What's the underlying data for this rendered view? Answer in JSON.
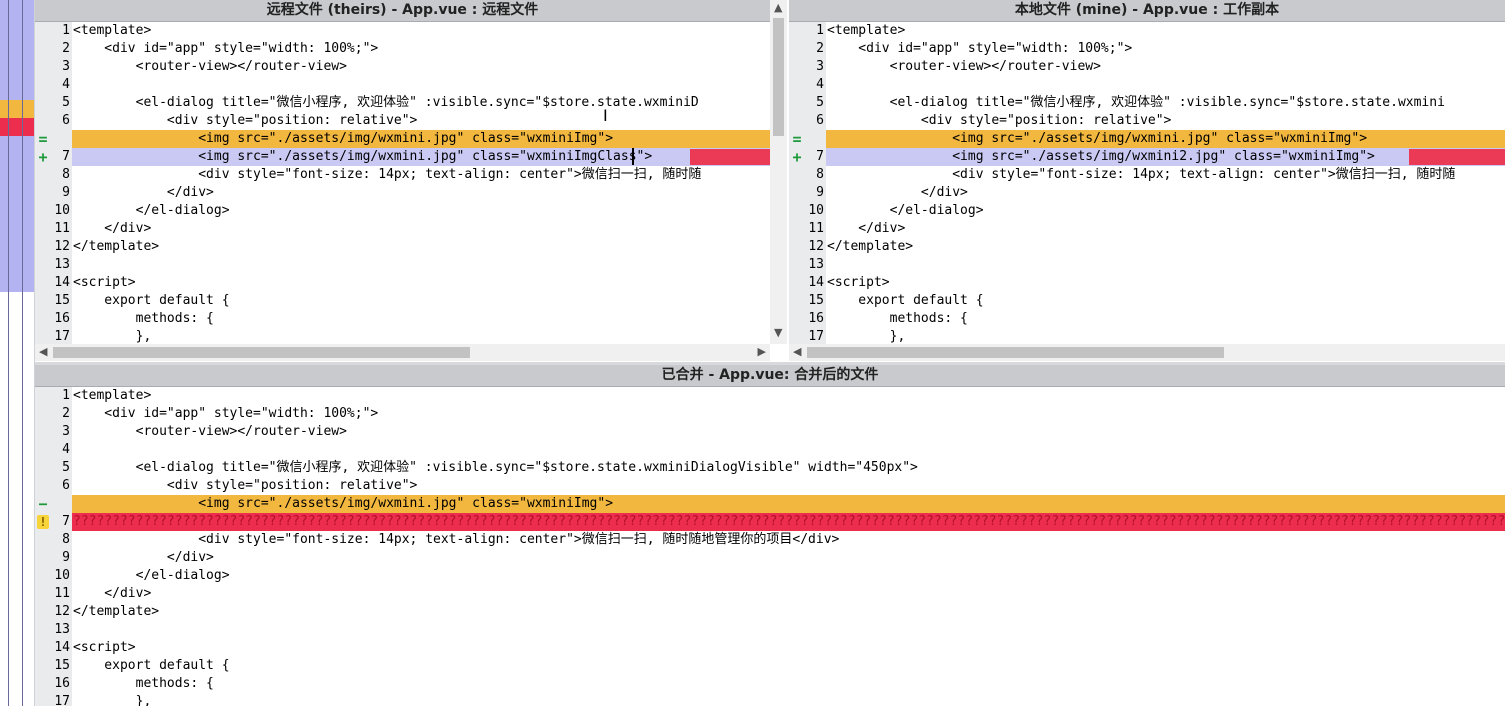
{
  "colors": {
    "conflict": "#f2b73f",
    "changed": "#c9c9f3",
    "error": "#ec2d4d",
    "highlight": "#f7f26a"
  },
  "left_pane": {
    "title": "远程文件 (theirs) - App.vue : 远程文件",
    "lines": [
      {
        "n": "1",
        "mark": "",
        "marker_icon": "",
        "code": "<template>"
      },
      {
        "n": "2",
        "mark": "",
        "marker_icon": "",
        "code": "    <div id=\"app\" style=\"width: 100%;\">"
      },
      {
        "n": "3",
        "mark": "",
        "marker_icon": "",
        "code": "        <router-view></router-view>"
      },
      {
        "n": "4",
        "mark": "",
        "marker_icon": "",
        "code": ""
      },
      {
        "n": "5",
        "mark": "",
        "marker_icon": "",
        "code": "        <el-dialog title=\"微信小程序, 欢迎体验\" :visible.sync=\"$store.state.wxminiD"
      },
      {
        "n": "6",
        "mark": "",
        "marker_icon": "",
        "code": "            <div style=\"position: relative\">"
      },
      {
        "n": "",
        "mark": "=",
        "marker_icon": "equal-icon",
        "code": "                <img src=\"./assets/img/wxmini.jpg\" class=\"wxminiImg\">"
      },
      {
        "n": "7",
        "mark": "+",
        "marker_icon": "plus-icon",
        "code": "                <img src=\"./assets/img/wxmini.jpg\" class=\"wxminiImgClass\">"
      },
      {
        "n": "8",
        "mark": "",
        "marker_icon": "",
        "code": "                <div style=\"font-size: 14px; text-align: center\">微信扫一扫, 随时随"
      },
      {
        "n": "9",
        "mark": "",
        "marker_icon": "",
        "code": "            </div>"
      },
      {
        "n": "10",
        "mark": "",
        "marker_icon": "",
        "code": "        </el-dialog>"
      },
      {
        "n": "11",
        "mark": "",
        "marker_icon": "",
        "code": "    </div>"
      },
      {
        "n": "12",
        "mark": "",
        "marker_icon": "",
        "code": "</template>"
      },
      {
        "n": "13",
        "mark": "",
        "marker_icon": "",
        "code": ""
      },
      {
        "n": "14",
        "mark": "",
        "marker_icon": "",
        "code": "<script>"
      },
      {
        "n": "15",
        "mark": "",
        "marker_icon": "",
        "code": "    export default {"
      },
      {
        "n": "16",
        "mark": "",
        "marker_icon": "",
        "code": "        methods: {"
      },
      {
        "n": "17",
        "mark": "",
        "marker_icon": "",
        "code": "        },"
      }
    ]
  },
  "right_pane": {
    "title": "本地文件 (mine) - App.vue : 工作副本",
    "lines": [
      {
        "n": "1",
        "mark": "",
        "marker_icon": "",
        "code": "<template>"
      },
      {
        "n": "2",
        "mark": "",
        "marker_icon": "",
        "code": "    <div id=\"app\" style=\"width: 100%;\">"
      },
      {
        "n": "3",
        "mark": "",
        "marker_icon": "",
        "code": "        <router-view></router-view>"
      },
      {
        "n": "4",
        "mark": "",
        "marker_icon": "",
        "code": ""
      },
      {
        "n": "5",
        "mark": "",
        "marker_icon": "",
        "code": "        <el-dialog title=\"微信小程序, 欢迎体验\" :visible.sync=\"$store.state.wxmini"
      },
      {
        "n": "6",
        "mark": "",
        "marker_icon": "",
        "code": "            <div style=\"position: relative\">"
      },
      {
        "n": "",
        "mark": "=",
        "marker_icon": "equal-icon",
        "code": "                <img src=\"./assets/img/wxmini.jpg\" class=\"wxminiImg\">"
      },
      {
        "n": "7",
        "mark": "+",
        "marker_icon": "plus-icon",
        "code": "                <img src=\"./assets/img/wxmini2.jpg\" class=\"wxminiImg\">"
      },
      {
        "n": "8",
        "mark": "",
        "marker_icon": "",
        "code": "                <div style=\"font-size: 14px; text-align: center\">微信扫一扫, 随时随"
      },
      {
        "n": "9",
        "mark": "",
        "marker_icon": "",
        "code": "            </div>"
      },
      {
        "n": "10",
        "mark": "",
        "marker_icon": "",
        "code": "        </el-dialog>"
      },
      {
        "n": "11",
        "mark": "",
        "marker_icon": "",
        "code": "    </div>"
      },
      {
        "n": "12",
        "mark": "",
        "marker_icon": "",
        "code": "</template>"
      },
      {
        "n": "13",
        "mark": "",
        "marker_icon": "",
        "code": ""
      },
      {
        "n": "14",
        "mark": "",
        "marker_icon": "",
        "code": "<script>"
      },
      {
        "n": "15",
        "mark": "",
        "marker_icon": "",
        "code": "    export default {"
      },
      {
        "n": "16",
        "mark": "",
        "marker_icon": "",
        "code": "        methods: {"
      },
      {
        "n": "17",
        "mark": "",
        "marker_icon": "",
        "code": "        },"
      }
    ]
  },
  "merged_pane": {
    "title": "已合并 - App.vue: 合并后的文件",
    "lines": [
      {
        "n": "1",
        "mark": "",
        "marker_icon": "",
        "code": "<template>"
      },
      {
        "n": "2",
        "mark": "",
        "marker_icon": "",
        "code": "    <div id=\"app\" style=\"width: 100%;\">"
      },
      {
        "n": "3",
        "mark": "",
        "marker_icon": "",
        "code": "        <router-view></router-view>"
      },
      {
        "n": "4",
        "mark": "",
        "marker_icon": "",
        "code": ""
      },
      {
        "n": "5",
        "mark": "",
        "marker_icon": "",
        "code": "        <el-dialog title=\"微信小程序, 欢迎体验\" :visible.sync=\"$store.state.wxminiDialogVisible\" width=\"450px\">"
      },
      {
        "n": "6",
        "mark": "",
        "marker_icon": "",
        "code": "            <div style=\"position: relative\">"
      },
      {
        "n": "",
        "mark": "−",
        "marker_icon": "minus-icon",
        "code": "                <img src=\"./assets/img/wxmini.jpg\" class=\"wxminiImg\">"
      },
      {
        "n": "7",
        "mark": "!",
        "marker_icon": "warning-icon",
        "code": "????????????????????????????????????????????????????????????????????????????????????????????????????????????????????????????????????????????????????????????????????????????????????????"
      },
      {
        "n": "8",
        "mark": "",
        "marker_icon": "",
        "code": "                <div style=\"font-size: 14px; text-align: center\">微信扫一扫, 随时随地管理你的项目</div>"
      },
      {
        "n": "9",
        "mark": "",
        "marker_icon": "",
        "code": "            </div>"
      },
      {
        "n": "10",
        "mark": "",
        "marker_icon": "",
        "code": "        </el-dialog>"
      },
      {
        "n": "11",
        "mark": "",
        "marker_icon": "",
        "code": "    </div>"
      },
      {
        "n": "12",
        "mark": "",
        "marker_icon": "",
        "code": "</template>"
      },
      {
        "n": "13",
        "mark": "",
        "marker_icon": "",
        "code": ""
      },
      {
        "n": "14",
        "mark": "",
        "marker_icon": "",
        "code": "<script>"
      },
      {
        "n": "15",
        "mark": "",
        "marker_icon": "",
        "code": "    export default {"
      },
      {
        "n": "16",
        "mark": "",
        "marker_icon": "",
        "code": "        methods: {"
      },
      {
        "n": "17",
        "mark": "",
        "marker_icon": "",
        "code": "        },"
      }
    ]
  }
}
